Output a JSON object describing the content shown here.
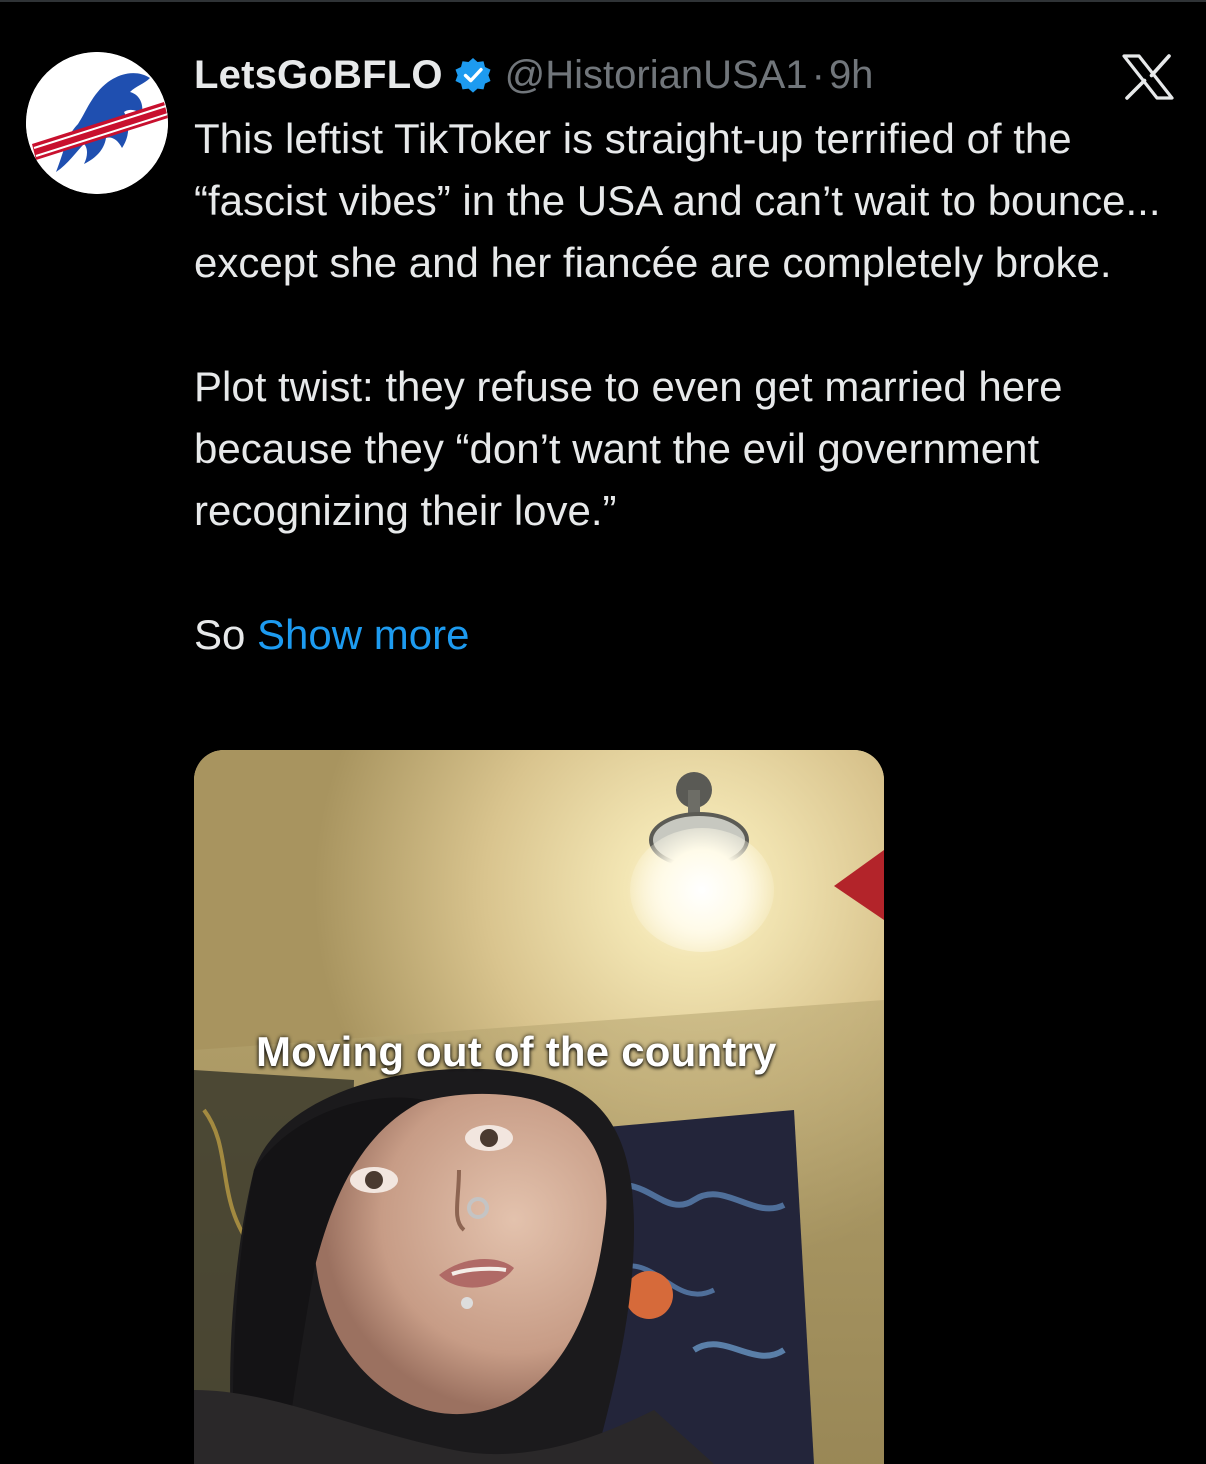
{
  "tweet": {
    "display_name": "LetsGoBFLO",
    "handle": "@HistorianUSA1",
    "separator": "·",
    "time": "9h",
    "paragraphs": [
      "This leftist TikToker is straight-up terrified of the “fascist vibes” in the USA and can’t wait to bounce... except she and her fiancée are completely broke.",
      "Plot twist: they refuse to even get married here because they “don’t want the evil government recognizing their love.”"
    ],
    "truncated_lead": "So",
    "show_more_label": "Show more",
    "media_caption": "Moving out of the country"
  },
  "icons": {
    "avatar": "buffalo-logo-avatar",
    "verified": "verified-badge-icon",
    "brand": "x-logo-icon"
  },
  "colors": {
    "background": "#000000",
    "text_primary": "#e7e9ea",
    "text_secondary": "#71767b",
    "link": "#1d9bf0",
    "verified": "#1d9bf0",
    "logo_blue": "#1f4fb0",
    "logo_red": "#c8102e"
  }
}
